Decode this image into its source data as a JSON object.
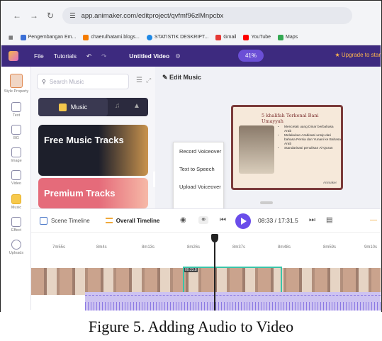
{
  "browser": {
    "url": "app.animaker.com/editproject/qvfmf96zlMnpcbx",
    "bookmarks": [
      "Pengembangan Em...",
      "chaerulhatami.blogs...",
      "STATISTIK DESKRIPT...",
      "Gmail",
      "YouTube",
      "Maps"
    ]
  },
  "app_header": {
    "menu_file": "File",
    "menu_tutorials": "Tutorials",
    "project_title": "Untitled Video",
    "zoom": "41%",
    "upgrade": "Upgrade to star"
  },
  "sidebar": {
    "items": [
      {
        "label": "Style Property"
      },
      {
        "label": "Text"
      },
      {
        "label": "BG"
      },
      {
        "label": "Image"
      },
      {
        "label": "Video"
      },
      {
        "label": "Music"
      },
      {
        "label": "Effect"
      },
      {
        "label": "Uploads"
      }
    ]
  },
  "music_panel": {
    "search_placeholder": "Search Music",
    "tab_music": "Music",
    "card1": "Free Music Tracks",
    "card2": "Premium Tracks"
  },
  "canvas": {
    "edit_music": "Edit Music",
    "slide_title": "5 khalifah Terkenal Bani Umayyah",
    "slide_bullets": [
      "Mencetak uang Dinar berbahasa Arab",
      "Melakukan Arabisasi unsip dari bahasa Persia dan Yunani ke Bahasa Arab",
      "Standarisasi penulisan Al-Quran"
    ],
    "slide_brand": "Animaker"
  },
  "voiceover_menu": {
    "items": [
      "Record Voiceover",
      "Text to Speech",
      "Upload Voiceover"
    ]
  },
  "timeline": {
    "scene_timeline": "Scene Timeline",
    "overall_timeline": "Overall Timeline",
    "timecode": "08:33 / 17:31.5",
    "ruler": [
      "7m55s",
      "8m4s",
      "8m13s",
      "8m26s",
      "8m37s",
      "8m48s",
      "8m59s",
      "9m10s"
    ],
    "clip_label": "00:23.8"
  },
  "caption": "Figure 5. Adding Audio to Video"
}
